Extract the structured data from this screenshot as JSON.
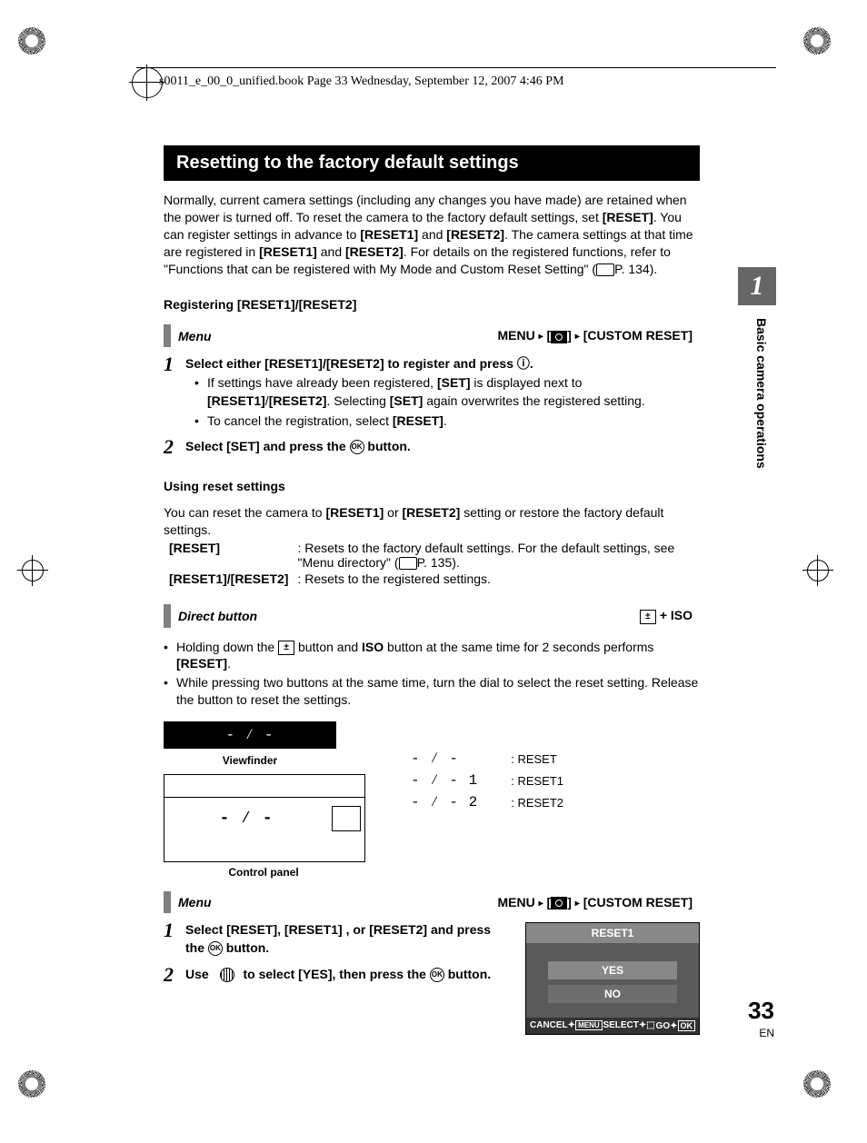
{
  "header": {
    "line": "s0011_e_00_0_unified.book  Page 33  Wednesday, September 12, 2007  4:46 PM"
  },
  "title": "Resetting to the factory default settings",
  "intro": {
    "text1": "Normally, current camera settings (including any changes you have made) are retained when the power is turned off. To reset the camera to the factory default settings, set ",
    "reset": "[RESET]",
    "text2": ". You can register settings in advance to ",
    "reset1": "[RESET1]",
    "and": " and ",
    "reset2": "[RESET2]",
    "text3": ". The camera settings at that time are registered in ",
    "text4": ". For details on the registered functions, refer to \"Functions that can be registered with My Mode and Custom Reset Setting\" (",
    "pref": "P. 134)."
  },
  "sec1_head": "Registering [RESET1]/[RESET2]",
  "menu_label": "Menu",
  "menu_word": "MENU",
  "menu_path_rest": "[CUSTOM RESET]",
  "step1_a": {
    "main": "Select either [RESET1]/[RESET2] to register and press ",
    "end": ".",
    "b1a": "If settings have already been registered, ",
    "b1b": "[SET]",
    "b1c": " is displayed next to ",
    "b1d": "[RESET1]",
    "b1e": "/",
    "b1f": "[RESET2]",
    "b1g": ". Selecting ",
    "b1h": "[SET]",
    "b1i": " again overwrites the registered setting.",
    "b2a": "To cancel the registration, select ",
    "b2b": "[RESET]",
    "b2c": "."
  },
  "step2_a": {
    "t1": "Select [SET] and press the ",
    "t2": " button."
  },
  "sec2_head": "Using reset settings",
  "para2": {
    "t1": "You can reset the camera to ",
    "r1": "[RESET1]",
    "t2": " or ",
    "r2": "[RESET2]",
    "t3": " setting or restore the factory default settings."
  },
  "reset_row": {
    "k": "[RESET]",
    "v1": ": Resets to the factory default settings. For the default settings, see \"Menu directory\" (",
    "v2": "P. 135)."
  },
  "reset12_row": {
    "k": "[RESET1]/[RESET2]",
    "v": ": Resets to the registered settings."
  },
  "direct_label": "Direct button",
  "direct_iso": "+ ISO",
  "direct_b1a": "Holding down the ",
  "direct_b1b": " button and ",
  "direct_b1c": "ISO",
  "direct_b1d": " button at the same time for 2 seconds performs ",
  "direct_b1e": "[RESET]",
  "direct_b1f": ".",
  "direct_b2": "While pressing two buttons at the same time, turn the dial to select the reset setting. Release the button to reset the settings.",
  "vf_glyph": "- ⁄ -",
  "vf_label": "Viewfinder",
  "cp_glyph": "- ⁄ -",
  "cp_label": "Control panel",
  "legend": {
    "r0": ": RESET",
    "r1": ": RESET1",
    "r2": ": RESET2",
    "g0": "- ⁄ -",
    "g1": "- ⁄ -  1",
    "g2": "- ⁄ -  2"
  },
  "step1_b": {
    "t1": "Select [RESET], [RESET1] , or [RESET2] and press the ",
    "t2": " button."
  },
  "step2_b": {
    "t1": "Use ",
    "t2": " to select [YES], then press the ",
    "t3": " button."
  },
  "screen": {
    "title": "RESET1",
    "yes": "YES",
    "no": "NO",
    "cancel": "CANCEL",
    "select": "SELECT",
    "go": "GO",
    "menu": "MENU",
    "ok": "OK"
  },
  "side": {
    "chapter": "1",
    "label": "Basic camera operations"
  },
  "page": {
    "num": "33",
    "lang": "EN"
  }
}
